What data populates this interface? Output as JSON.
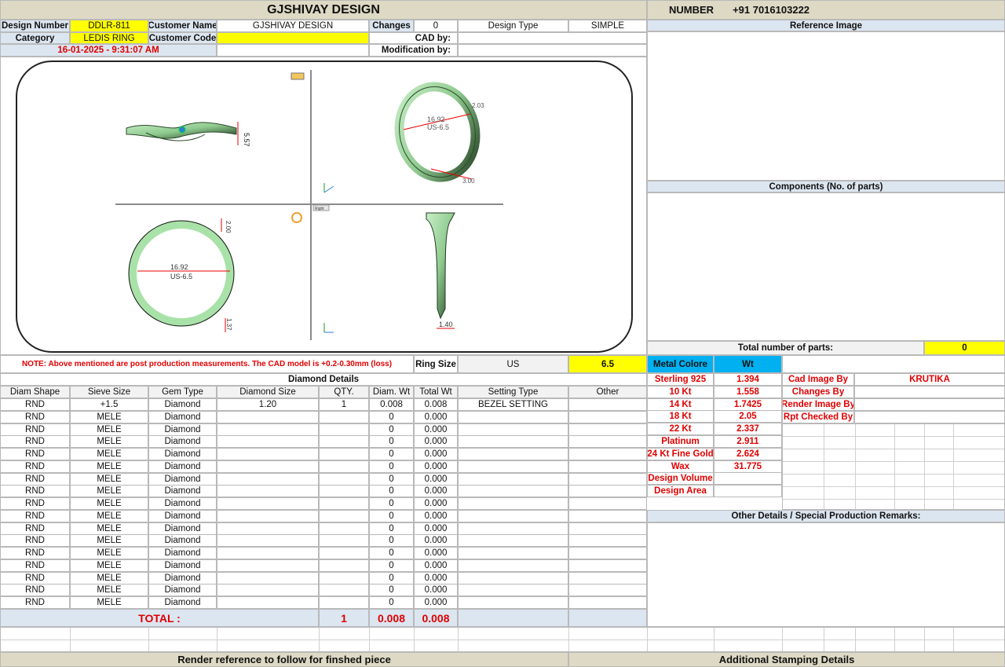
{
  "header": {
    "title": "GJSHIVAY DESIGN",
    "number_label": "NUMBER",
    "number_value": "+91 7016103222"
  },
  "info": {
    "design_number_label": "Design Number",
    "design_number": "DDLR-811",
    "customer_name_label": "Customer Name",
    "customer_name": "GJSHIVAY DESIGN",
    "changes_label": "Changes",
    "changes": "0",
    "design_type_label": "Design Type",
    "design_type": "SIMPLE",
    "category_label": "Category",
    "category": "LEDIS RING",
    "customer_code_label": "Customer Code",
    "customer_code": "",
    "cad_by_label": "CAD by:",
    "cad_by": "",
    "timestamp": "16-01-2025 - 9:31:07 AM",
    "modification_label": "Modification by:",
    "modification": ""
  },
  "cad": {
    "dim_top_height": "5.57",
    "dim_top_diam": "16.92",
    "dim_top_size": "US-6.5",
    "dim_top_a": "2.03",
    "dim_top_b": "3.00",
    "dim_bottom_diam": "16.92",
    "dim_bottom_size": "US-6.5",
    "dim_bottom_top": "2.00",
    "dim_bottom_shank": "1.40",
    "dim_bottom_low": "1.37",
    "viewport_label": "Right"
  },
  "note": {
    "text": "NOTE: Above mentioned are post production measurements. The CAD model is +0.2-0.30mm (loss)",
    "ring_size_label": "Ring Size",
    "ring_size_system": "US",
    "ring_size_value": "6.5"
  },
  "diamond": {
    "title": "Diamond Details",
    "headers": [
      "Diam Shape",
      "Sieve Size",
      "Gem Type",
      "Diamond Size",
      "QTY.",
      "Diam. Wt",
      "Total Wt",
      "Setting Type",
      "Other"
    ],
    "rows": [
      [
        "RND",
        "+1.5",
        "Diamond",
        "1.20",
        "1",
        "0.008",
        "0.008",
        "BEZEL SETTING",
        ""
      ],
      [
        "RND",
        "MELE",
        "Diamond",
        "",
        "",
        "0",
        "0.000",
        "",
        ""
      ],
      [
        "RND",
        "MELE",
        "Diamond",
        "",
        "",
        "0",
        "0.000",
        "",
        ""
      ],
      [
        "RND",
        "MELE",
        "Diamond",
        "",
        "",
        "0",
        "0.000",
        "",
        ""
      ],
      [
        "RND",
        "MELE",
        "Diamond",
        "",
        "",
        "0",
        "0.000",
        "",
        ""
      ],
      [
        "RND",
        "MELE",
        "Diamond",
        "",
        "",
        "0",
        "0.000",
        "",
        ""
      ],
      [
        "RND",
        "MELE",
        "Diamond",
        "",
        "",
        "0",
        "0.000",
        "",
        ""
      ],
      [
        "RND",
        "MELE",
        "Diamond",
        "",
        "",
        "0",
        "0.000",
        "",
        ""
      ],
      [
        "RND",
        "MELE",
        "Diamond",
        "",
        "",
        "0",
        "0.000",
        "",
        ""
      ],
      [
        "RND",
        "MELE",
        "Diamond",
        "",
        "",
        "0",
        "0.000",
        "",
        ""
      ],
      [
        "RND",
        "MELE",
        "Diamond",
        "",
        "",
        "0",
        "0.000",
        "",
        ""
      ],
      [
        "RND",
        "MELE",
        "Diamond",
        "",
        "",
        "0",
        "0.000",
        "",
        ""
      ],
      [
        "RND",
        "MELE",
        "Diamond",
        "",
        "",
        "0",
        "0.000",
        "",
        ""
      ],
      [
        "RND",
        "MELE",
        "Diamond",
        "",
        "",
        "0",
        "0.000",
        "",
        ""
      ],
      [
        "RND",
        "MELE",
        "Diamond",
        "",
        "",
        "0",
        "0.000",
        "",
        ""
      ],
      [
        "RND",
        "MELE",
        "Diamond",
        "",
        "",
        "0",
        "0.000",
        "",
        ""
      ],
      [
        "RND",
        "MELE",
        "Diamond",
        "",
        "",
        "0",
        "0.000",
        "",
        ""
      ]
    ],
    "total_label": "TOTAL :",
    "total_qty": "1",
    "total_diam_wt": "0.008",
    "total_wt": "0.008"
  },
  "right": {
    "reference_image": "Reference Image",
    "components": "Components (No. of parts)",
    "total_parts_label": "Total number of parts:",
    "total_parts": "0",
    "metal_colore": "Metal Colore",
    "wt": "Wt",
    "metals": [
      {
        "name": "Sterling 925",
        "wt": "1.394"
      },
      {
        "name": "10 Kt",
        "wt": "1.558"
      },
      {
        "name": "14 Kt",
        "wt": "1.7425"
      },
      {
        "name": "18 Kt",
        "wt": "2.05"
      },
      {
        "name": "22 Kt",
        "wt": "2.337"
      },
      {
        "name": "Platinum",
        "wt": "2.911"
      },
      {
        "name": "24 Kt Fine Gold",
        "wt": "2.624"
      },
      {
        "name": "Wax",
        "wt": "31.775"
      },
      {
        "name": "Design Volume",
        "wt": ""
      },
      {
        "name": "Design Area",
        "wt": ""
      }
    ],
    "cad_image_by_label": "Cad Image By",
    "cad_image_by": "KRUTIKA",
    "changes_by_label": "Changes By",
    "render_image_by_label": "Render Image By",
    "rpt_checked_by_label": "Rpt Checked By",
    "other_details": "Other Details / Special Production Remarks:"
  },
  "footer": {
    "render_reference": "Render reference to follow for finshed piece",
    "stamping": "Additional Stamping Details"
  },
  "colors": {
    "header_tan": "#ddd9c4",
    "label_blue": "#dce6f1",
    "highlight_yellow": "#ffff00",
    "metal_cyan": "#00b0f0",
    "text_red": "#e00000",
    "ring_green": "#9fd49f"
  }
}
